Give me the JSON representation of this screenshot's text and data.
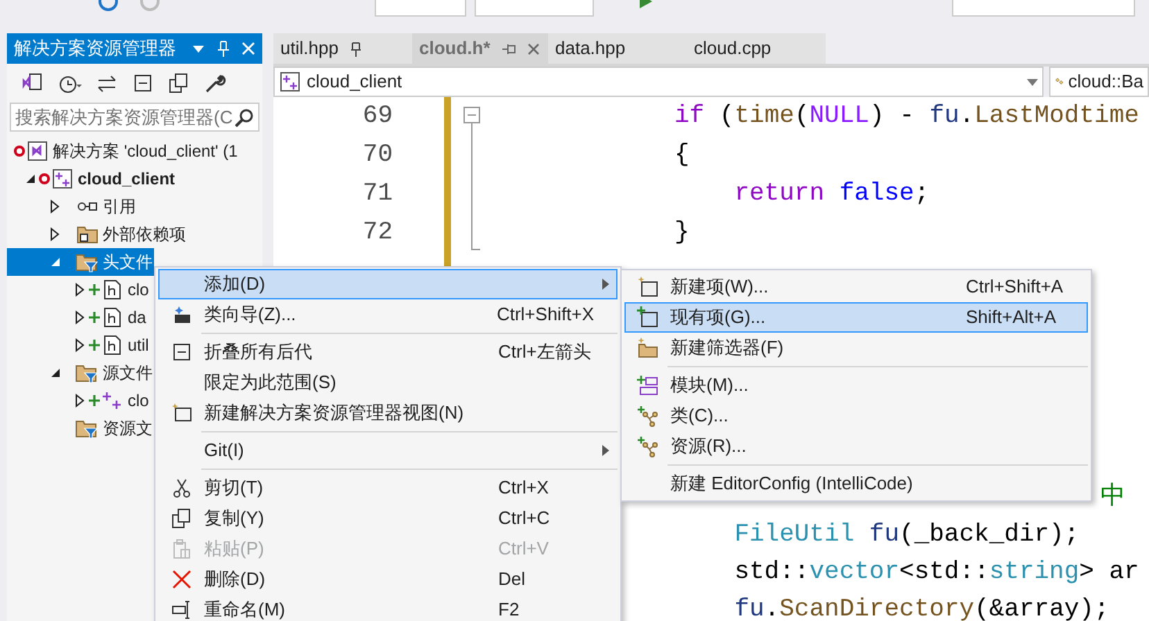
{
  "solution_explorer": {
    "title": "解决方案资源管理器",
    "search": {
      "placeholder": "搜索解决方案资源管理器(C"
    },
    "tree": [
      {
        "label": "解决方案 'cloud_client' (1",
        "kind": "solution",
        "modified": true,
        "added": false,
        "selected": false,
        "children": [
          {
            "label": "cloud_client",
            "kind": "project",
            "modified": true,
            "added": false,
            "expanded": true,
            "selected": false,
            "children": [
              {
                "label": "引用",
                "kind": "references",
                "modified": false,
                "added": false,
                "expanded": false,
                "selected": false
              },
              {
                "label": "外部依赖项",
                "kind": "external",
                "modified": false,
                "added": false,
                "expanded": false,
                "selected": false
              },
              {
                "label": "头文件",
                "kind": "filter",
                "modified": false,
                "added": false,
                "expanded": true,
                "selected": true,
                "children": [
                  {
                    "label": "clo",
                    "kind": "header",
                    "modified": false,
                    "added": true,
                    "expanded": false,
                    "selected": false
                  },
                  {
                    "label": "da",
                    "kind": "header",
                    "modified": false,
                    "added": true,
                    "expanded": false,
                    "selected": false
                  },
                  {
                    "label": "util",
                    "kind": "header",
                    "modified": false,
                    "added": true,
                    "expanded": false,
                    "selected": false
                  }
                ]
              },
              {
                "label": "源文件",
                "kind": "filter",
                "modified": false,
                "added": false,
                "expanded": true,
                "selected": false,
                "children": [
                  {
                    "label": "clo",
                    "kind": "source",
                    "modified": false,
                    "added": true,
                    "expanded": false,
                    "selected": false
                  }
                ]
              },
              {
                "label": "资源文",
                "kind": "filter",
                "modified": false,
                "added": false,
                "selected": false
              }
            ]
          }
        ]
      }
    ]
  },
  "tabs": [
    {
      "label": "util.hpp",
      "selected": false,
      "pinned": true
    },
    {
      "label": "cloud.h*",
      "selected": true,
      "pinned": false
    },
    {
      "label": "data.hpp",
      "selected": false,
      "pinned": false
    },
    {
      "label": "cloud.cpp",
      "selected": false,
      "pinned": false
    }
  ],
  "navigation": {
    "project": "cloud_client",
    "scope": "cloud::Ba"
  },
  "code": {
    "lines": [
      {
        "number": "69",
        "tokens": [
          {
            "text": "if",
            "kind": "kw"
          },
          {
            "text": " (",
            "kind": "plain"
          },
          {
            "text": "time",
            "kind": "fn"
          },
          {
            "text": "(",
            "kind": "plain"
          },
          {
            "text": "NULL",
            "kind": "macro"
          },
          {
            "text": ") - ",
            "kind": "plain"
          },
          {
            "text": "fu",
            "kind": "var"
          },
          {
            "text": ".",
            "kind": "plain"
          },
          {
            "text": "LastModtime",
            "kind": "fn"
          }
        ]
      },
      {
        "number": "70",
        "tokens": [
          {
            "text": "{",
            "kind": "plain"
          }
        ]
      },
      {
        "number": "71",
        "tokens": [
          {
            "text": "    return",
            "kind": "kw"
          },
          {
            "text": " false",
            "kind": "lit"
          },
          {
            "text": ";",
            "kind": "plain"
          }
        ]
      },
      {
        "number": "72",
        "tokens": [
          {
            "text": "}",
            "kind": "plain"
          }
        ]
      }
    ],
    "lines_below": [
      {
        "kind": "tail",
        "tokens": [
          {
            "text": "中",
            "kind": "comment"
          }
        ]
      },
      {
        "kind": "code",
        "tokens": [
          {
            "text": "    FileUtil",
            "kind": "type"
          },
          {
            "text": " fu",
            "kind": "var"
          },
          {
            "text": "(_back_dir);",
            "kind": "plain"
          }
        ]
      },
      {
        "kind": "code",
        "tokens": [
          {
            "text": "    std::",
            "kind": "plain"
          },
          {
            "text": "vector",
            "kind": "type"
          },
          {
            "text": "<std::",
            "kind": "plain"
          },
          {
            "text": "string",
            "kind": "type"
          },
          {
            "text": "> ar",
            "kind": "plain"
          }
        ]
      },
      {
        "kind": "code",
        "tokens": [
          {
            "text": "    fu",
            "kind": "var"
          },
          {
            "text": ".",
            "kind": "plain"
          },
          {
            "text": "ScanDirectory",
            "kind": "fn"
          },
          {
            "text": "(&array);",
            "kind": "plain"
          }
        ]
      }
    ]
  },
  "context_menu": [
    {
      "kind": "submenu",
      "label": "添加(D)",
      "selected": true,
      "disabled": false
    },
    {
      "kind": "item",
      "label": "类向导(Z)...",
      "shortcut": "Ctrl+Shift+X",
      "selected": false,
      "disabled": false
    },
    {
      "kind": "separator"
    },
    {
      "kind": "item",
      "label": "折叠所有后代",
      "shortcut": "Ctrl+左箭头",
      "selected": false,
      "disabled": false
    },
    {
      "kind": "item",
      "label": "限定为此范围(S)",
      "selected": false,
      "disabled": false
    },
    {
      "kind": "item",
      "label": "新建解决方案资源管理器视图(N)",
      "selected": false,
      "disabled": false
    },
    {
      "kind": "separator"
    },
    {
      "kind": "submenu",
      "label": "Git(I)",
      "selected": false,
      "disabled": false
    },
    {
      "kind": "separator"
    },
    {
      "kind": "item",
      "label": "剪切(T)",
      "shortcut": "Ctrl+X",
      "selected": false,
      "disabled": false
    },
    {
      "kind": "item",
      "label": "复制(Y)",
      "shortcut": "Ctrl+C",
      "selected": false,
      "disabled": false
    },
    {
      "kind": "item",
      "label": "粘贴(P)",
      "shortcut": "Ctrl+V",
      "selected": false,
      "disabled": true
    },
    {
      "kind": "item",
      "label": "删除(D)",
      "shortcut": "Del",
      "selected": false,
      "disabled": false
    },
    {
      "kind": "item",
      "label": "重命名(M)",
      "shortcut": "F2",
      "selected": false,
      "disabled": false
    }
  ],
  "add_submenu": [
    {
      "kind": "item",
      "label": "新建项(W)...",
      "shortcut": "Ctrl+Shift+A",
      "selected": false,
      "disabled": false
    },
    {
      "kind": "item",
      "label": "现有项(G)...",
      "shortcut": "Shift+Alt+A",
      "selected": true,
      "disabled": false
    },
    {
      "kind": "item",
      "label": "新建筛选器(F)",
      "selected": false,
      "disabled": false
    },
    {
      "kind": "separator"
    },
    {
      "kind": "item",
      "label": "模块(M)...",
      "selected": false,
      "disabled": false
    },
    {
      "kind": "item",
      "label": "类(C)...",
      "selected": false,
      "disabled": false
    },
    {
      "kind": "item",
      "label": "资源(R)...",
      "selected": false,
      "disabled": false
    },
    {
      "kind": "separator"
    },
    {
      "kind": "item",
      "label": "新建 EditorConfig (IntelliCode)",
      "selected": false,
      "disabled": false
    }
  ]
}
